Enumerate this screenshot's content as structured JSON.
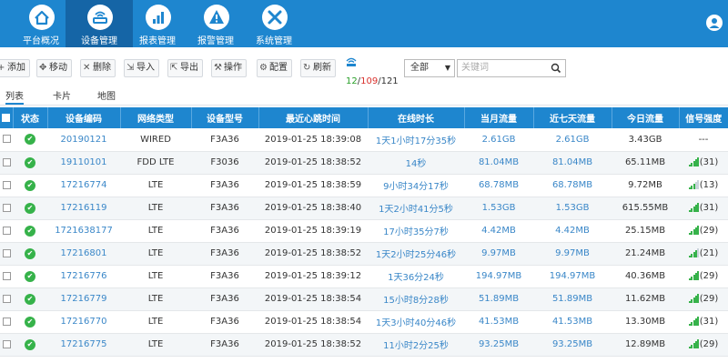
{
  "nav": [
    {
      "label": "平台概况",
      "icon": "home-icon"
    },
    {
      "label": "设备管理",
      "icon": "router-icon"
    },
    {
      "label": "报表管理",
      "icon": "report-chart-icon"
    },
    {
      "label": "报警管理",
      "icon": "warning-icon"
    },
    {
      "label": "系统管理",
      "icon": "tools-icon"
    }
  ],
  "toolbar": {
    "buttons": [
      {
        "label": "添加",
        "icon": "plus-icon",
        "glyph": "+"
      },
      {
        "label": "移动",
        "icon": "move-icon",
        "glyph": "✥"
      },
      {
        "label": "删除",
        "icon": "delete-icon",
        "glyph": "✕"
      },
      {
        "label": "导入",
        "icon": "import-icon",
        "glyph": "⇲"
      },
      {
        "label": "导出",
        "icon": "export-icon",
        "glyph": "⇱"
      },
      {
        "label": "操作",
        "icon": "wrench-icon",
        "glyph": "⚒"
      },
      {
        "label": "配置",
        "icon": "gear-icon",
        "glyph": "⚙"
      },
      {
        "label": "刷新",
        "icon": "refresh-icon",
        "glyph": "↻"
      }
    ],
    "count_online": "12",
    "count_sep1": "/",
    "count_alert": "109",
    "count_sep2": "/",
    "count_total": "121",
    "filter_value": "全部",
    "search_placeholder": "关键词"
  },
  "tabs": [
    "列表",
    "卡片",
    "地图"
  ],
  "table": {
    "headers": [
      "状态",
      "设备编码",
      "网络类型",
      "设备型号",
      "最近心跳时间",
      "在线时长",
      "当月流量",
      "近七天流量",
      "今日流量",
      "信号强度"
    ],
    "rows": [
      {
        "code": "20190121",
        "net": "WIRED",
        "model": "F3A36",
        "time": "2019-01-25 18:39:08",
        "online": "1天1小时17分35秒",
        "month": "2.61GB",
        "week": "2.61GB",
        "today": "3.43GB",
        "signal": "---",
        "bars": 0
      },
      {
        "code": "19110101",
        "net": "FDD LTE",
        "model": "F3036",
        "time": "2019-01-25 18:38:52",
        "online": "14秒",
        "month": "81.04MB",
        "week": "81.04MB",
        "today": "65.11MB",
        "signal": "(31)",
        "bars": 5
      },
      {
        "code": "17216774",
        "net": "LTE",
        "model": "F3A36",
        "time": "2019-01-25 18:38:59",
        "online": "9小时34分17秒",
        "month": "68.78MB",
        "week": "68.78MB",
        "today": "9.72MB",
        "signal": "(13)",
        "bars": 3
      },
      {
        "code": "17216119",
        "net": "LTE",
        "model": "F3A36",
        "time": "2019-01-25 18:38:40",
        "online": "1天2小时41分5秒",
        "month": "1.53GB",
        "week": "1.53GB",
        "today": "615.55MB",
        "signal": "(31)",
        "bars": 5
      },
      {
        "code": "1721638177",
        "net": "LTE",
        "model": "F3A36",
        "time": "2019-01-25 18:39:19",
        "online": "17小时35分7秒",
        "month": "4.42MB",
        "week": "4.42MB",
        "today": "25.15MB",
        "signal": "(29)",
        "bars": 5
      },
      {
        "code": "17216801",
        "net": "LTE",
        "model": "F3A36",
        "time": "2019-01-25 18:38:52",
        "online": "1天2小时25分46秒",
        "month": "9.97MB",
        "week": "9.97MB",
        "today": "21.24MB",
        "signal": "(21)",
        "bars": 4
      },
      {
        "code": "17216776",
        "net": "LTE",
        "model": "F3A36",
        "time": "2019-01-25 18:39:12",
        "online": "1天36分24秒",
        "month": "194.97MB",
        "week": "194.97MB",
        "today": "40.36MB",
        "signal": "(29)",
        "bars": 5
      },
      {
        "code": "17216779",
        "net": "LTE",
        "model": "F3A36",
        "time": "2019-01-25 18:38:54",
        "online": "15小时8分28秒",
        "month": "51.89MB",
        "week": "51.89MB",
        "today": "11.62MB",
        "signal": "(29)",
        "bars": 5
      },
      {
        "code": "17216770",
        "net": "LTE",
        "model": "F3A36",
        "time": "2019-01-25 18:38:54",
        "online": "1天3小时40分46秒",
        "month": "41.53MB",
        "week": "41.53MB",
        "today": "13.30MB",
        "signal": "(31)",
        "bars": 5
      },
      {
        "code": "17216775",
        "net": "LTE",
        "model": "F3A36",
        "time": "2019-01-25 18:38:52",
        "online": "11小时2分25秒",
        "month": "93.25MB",
        "week": "93.25MB",
        "today": "12.89MB",
        "signal": "(29)",
        "bars": 5
      }
    ]
  },
  "colors": {
    "primary": "#1e86cf",
    "nav_active": "#1565a6",
    "online": "#36b24a",
    "alert": "#d9302c"
  }
}
